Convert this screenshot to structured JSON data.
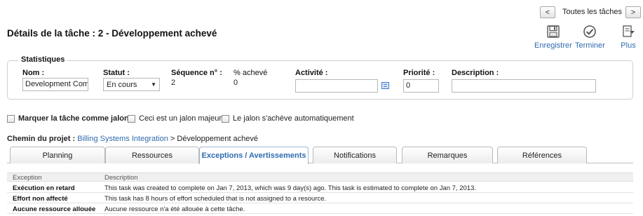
{
  "nav": {
    "prev_label": "<",
    "all_tasks_label": "Toutes les tâches",
    "next_label": ">"
  },
  "page": {
    "title": "Détails de la tâche : 2 - Développement achevé"
  },
  "toolbar": {
    "save_label": "Enregistrer",
    "finish_label": "Terminer",
    "more_label": "Plus"
  },
  "stats": {
    "legend": "Statistiques",
    "name_label": "Nom :",
    "name_value": "Development Com",
    "status_label": "Statut :",
    "status_value": "En cours",
    "sequence_label": "Séquence n° :",
    "sequence_value": "2",
    "percent_label": "% achevé",
    "percent_value": "0",
    "activity_label": "Activité :",
    "activity_value": "",
    "priority_label": "Priorité :",
    "priority_value": "0",
    "description_label": "Description :",
    "description_value": ""
  },
  "milestone": {
    "mark_label": "Marquer la tâche comme jalon",
    "major_label": "Ceci est un jalon majeur",
    "auto_label": "Le jalon s'achève automatiquement"
  },
  "path": {
    "prefix": "Chemin du projet :",
    "project_link": "Billing Systems Integration",
    "current": "> Développement achevé"
  },
  "tabs": [
    {
      "label": "Planning",
      "active": false
    },
    {
      "label": "Ressources",
      "active": false
    },
    {
      "label": "Exceptions / Avertissements",
      "active": true
    },
    {
      "label": "Notifications",
      "active": false
    },
    {
      "label": "Remarques",
      "active": false
    },
    {
      "label": "Références",
      "active": false
    }
  ],
  "exceptions": {
    "headers": [
      "Exception",
      "Description"
    ],
    "rows": [
      {
        "exception": "Exécution en retard",
        "description": "This task was created to complete on Jan 7, 2013, which was 9 day(s) ago. This task is estimated to complete on Jan 7, 2013."
      },
      {
        "exception": "Effort non affecté",
        "description": "This task has 8 hours of effort scheduled that is not assigned to a resource."
      },
      {
        "exception": "Aucune ressource allouée",
        "description": "Aucune ressource n'a été allouée à cette tâche."
      }
    ]
  },
  "colors": {
    "link": "#2f6bb0",
    "tab_border": "#b8b8b8"
  }
}
